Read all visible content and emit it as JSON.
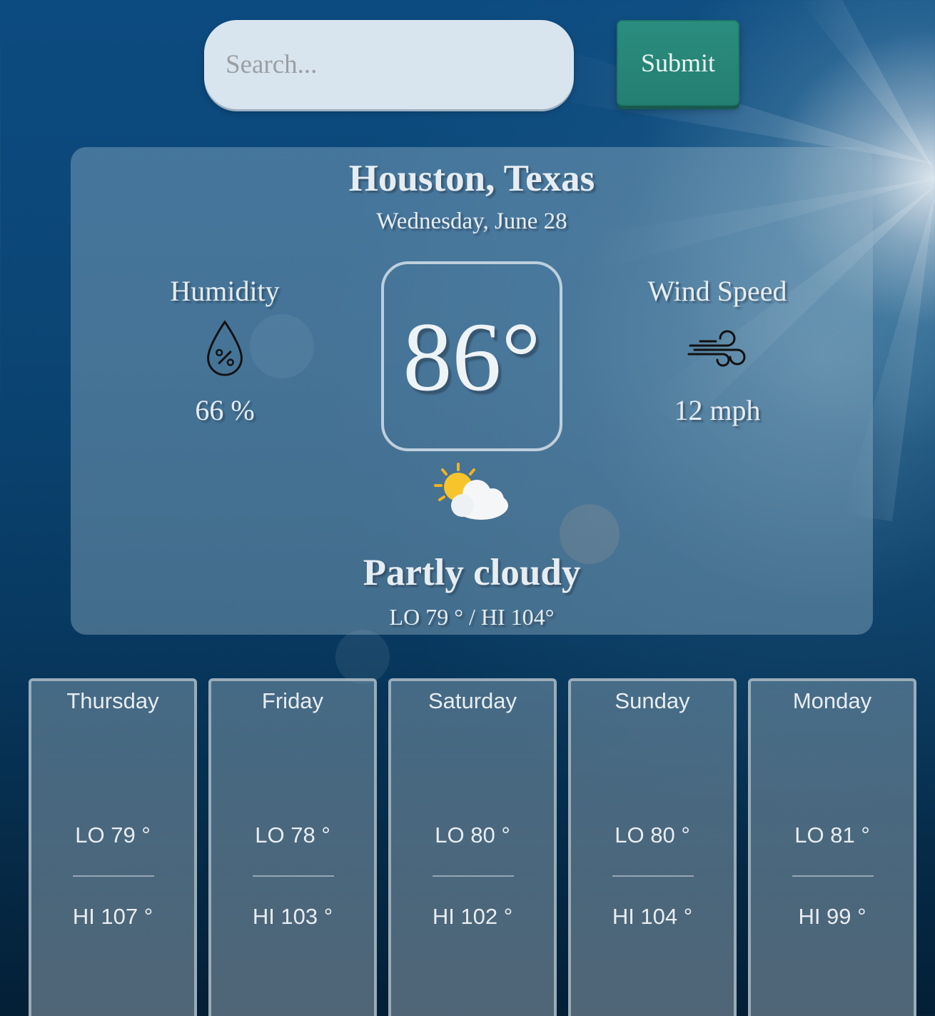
{
  "search": {
    "placeholder": "Search..."
  },
  "submit_label": "Submit",
  "current": {
    "city": "Houston, Texas",
    "date": "Wednesday, June 28",
    "humidity_label": "Humidity",
    "humidity_value": "66 %",
    "wind_label": "Wind Speed",
    "wind_value": "12 mph",
    "temperature": "86°",
    "condition": "Partly cloudy",
    "lo_hi": "LO 79 ° / HI 104°"
  },
  "icons": {
    "humidity": "humidity-drop-icon",
    "wind": "wind-icon",
    "weather": "partly-cloudy-icon"
  },
  "forecast": [
    {
      "day": "Thursday",
      "lo": "LO 79 °",
      "hi": "HI 107 °"
    },
    {
      "day": "Friday",
      "lo": "LO 78 °",
      "hi": "HI 103 °"
    },
    {
      "day": "Saturday",
      "lo": "LO 80 °",
      "hi": "HI 102 °"
    },
    {
      "day": "Sunday",
      "lo": "LO 80 °",
      "hi": "HI 104 °"
    },
    {
      "day": "Monday",
      "lo": "LO 81 °",
      "hi": "HI 99 °"
    }
  ],
  "colors": {
    "background": "#0b4574",
    "submit": "#247f72",
    "search_bg": "#d8e4ee"
  }
}
